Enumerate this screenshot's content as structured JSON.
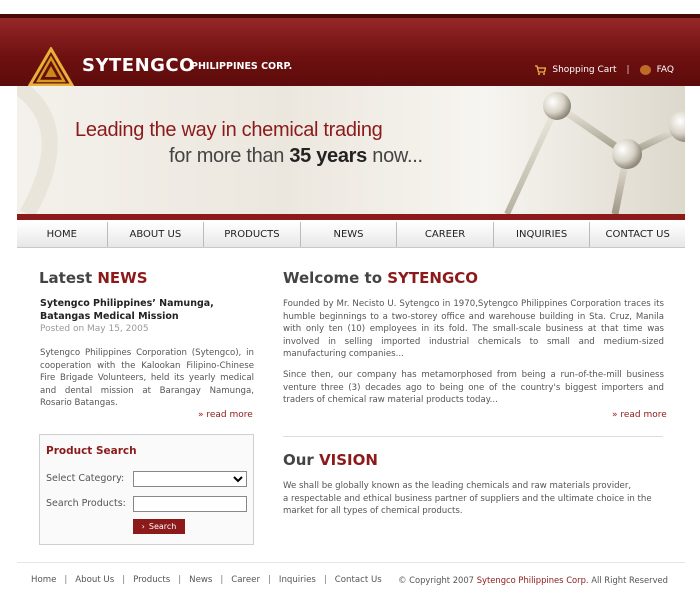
{
  "brand": {
    "name": "SYTENGCO",
    "subtitle": "PHILIPPINES CORP.",
    "color": "#8c1a1a"
  },
  "top_links": [
    {
      "label": "Shopping Cart",
      "icon": "cart-icon"
    },
    {
      "label": "FAQ",
      "icon": "faq-icon"
    }
  ],
  "hero": {
    "line1": "Leading the way in chemical trading",
    "line2_prefix": "for more than ",
    "line2_bold": "35 years",
    "line2_suffix": " now..."
  },
  "nav": [
    "HOME",
    "ABOUT US",
    "PRODUCTS",
    "NEWS",
    "CAREER",
    "INQUIRIES",
    "CONTACT US"
  ],
  "news": {
    "title_plain": "Latest ",
    "title_hl": "NEWS",
    "headline": "Sytengco Philippines’ Namunga, Batangas Medical Mission",
    "date": "Posted on May 15, 2005",
    "body": "Sytengco Philippines Corporation (Sytengco), in cooperation with the Kalookan Filipino-Chinese Fire Brigade Volunteers, held its yearly medical and dental mission at Barangay Namunga, Rosario Batangas.",
    "read_more": "» read more"
  },
  "product_search": {
    "title": "Product Search",
    "category_label": "Select Category:",
    "products_label": "Search Products:",
    "category_value": "",
    "products_value": "",
    "button": "Search"
  },
  "welcome": {
    "title_plain": "Welcome to ",
    "title_hl": "SYTENGCO",
    "para1": "Founded by Mr. Necisto U. Sytengco in 1970,Sytengco Philippines Corporation traces its humble beginnings to a two-storey office and warehouse building in Sta. Cruz, Manila with only ten (10) employees in its fold. The small-scale business at that time was involved in selling imported industrial chemicals to small and medium-sized manufacturing companies...",
    "para2": "Since then, our company has metamorphosed from being a run-of-the-mill business venture three (3) decades ago to being one of the country's biggest importers and traders of chemical raw material products today...",
    "read_more": "» read more"
  },
  "vision": {
    "title_plain": "Our ",
    "title_hl": "VISION",
    "line1": "We shall be globally known as the leading chemicals and raw materials provider,",
    "line2": "a respectable and ethical business partner of suppliers and the ultimate choice in the market for all types of chemical products."
  },
  "footer": {
    "links": [
      "Home",
      "About Us",
      "Products",
      "News",
      "Career",
      "Inquiries",
      "Contact Us"
    ],
    "copyright_prefix": "© Copyright 2007 ",
    "copyright_company": "Sytengco Philippines Corp.",
    "copyright_suffix": " All Right Reserved"
  }
}
